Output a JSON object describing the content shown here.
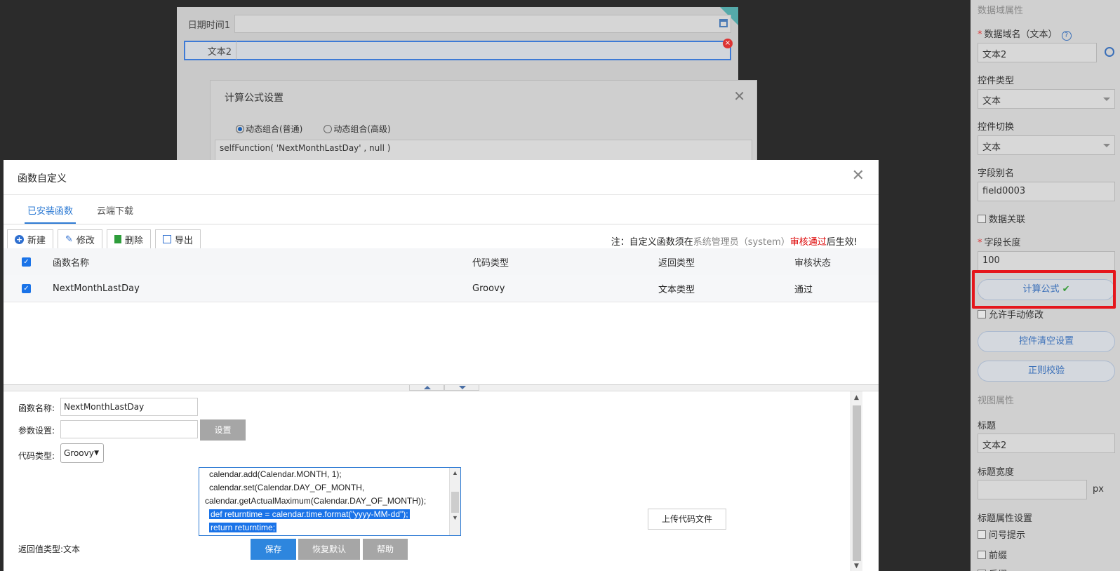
{
  "background_form": {
    "datetime_label": "日期时间1",
    "text_label": "文本2"
  },
  "formula_dialog": {
    "title": "计算公式设置",
    "radio_normal": "动态组合(普通)",
    "radio_advanced": "动态组合(高级)",
    "expression": "selfFunction( 'NextMonthLastDay' , null )"
  },
  "right_panel": {
    "section_data": "数据域属性",
    "domain_name_label": "数据域名（文本）",
    "domain_name_value": "文本2",
    "control_type_label": "控件类型",
    "control_type_value": "文本",
    "control_switch_label": "控件切换",
    "control_switch_value": "文本",
    "field_alias_label": "字段别名",
    "field_alias_value": "field0003",
    "data_link_label": "数据关联",
    "field_length_label": "字段长度",
    "field_length_value": "100",
    "calc_formula_label": "计算公式",
    "allow_manual_label": "允许手动修改",
    "clear_settings_label": "控件清空设置",
    "regex_label": "正则校验",
    "section_view": "视图属性",
    "title_label": "标题",
    "title_value": "文本2",
    "title_width_label": "标题宽度",
    "px_unit": "px",
    "title_props_label": "标题属性设置",
    "question_tip_label": "问号提示",
    "prefix_label": "前缀",
    "suffix_label": "后缀"
  },
  "main_dialog": {
    "title": "函数自定义",
    "tabs": [
      {
        "label": "已安装函数",
        "active": true
      },
      {
        "label": "云端下载",
        "active": false
      }
    ],
    "toolbar": {
      "new": "新建",
      "edit": "修改",
      "delete": "删除",
      "export": "导出"
    },
    "note": {
      "prefix": "注：自定义函数须在",
      "admin": "系统管理员（system）",
      "approved": "审核通过",
      "suffix": "后生效!"
    },
    "columns": [
      "函数名称",
      "代码类型",
      "返回类型",
      "审核状态"
    ],
    "rows": [
      {
        "name": "NextMonthLastDay",
        "code_type": "Groovy",
        "return_type": "文本类型",
        "status": "通过"
      }
    ],
    "form": {
      "func_name_label": "函数名称:",
      "func_name_value": "NextMonthLastDay",
      "param_label": "参数设置:",
      "param_value": "",
      "set_button": "设置",
      "code_type_label": "代码类型:",
      "code_type_value": "Groovy",
      "code_lines": [
        "calendar.add(Calendar.MONTH, 1);",
        "calendar.set(Calendar.DAY_OF_MONTH,",
        "calendar.getActualMaximum(Calendar.DAY_OF_MONTH));",
        "def returntime = calendar.time.format(\"yyyy-MM-dd\");",
        "return returntime;"
      ],
      "upload_button": "上传代码文件",
      "return_type_label": "返回值类型:",
      "return_type_value": "文本",
      "save_button": "保存",
      "restore_button": "恢复默认",
      "help_button": "帮助"
    }
  },
  "colors": {
    "accent": "#2e86de",
    "highlight_red": "#e5161b",
    "approved_red": "#d00000"
  }
}
